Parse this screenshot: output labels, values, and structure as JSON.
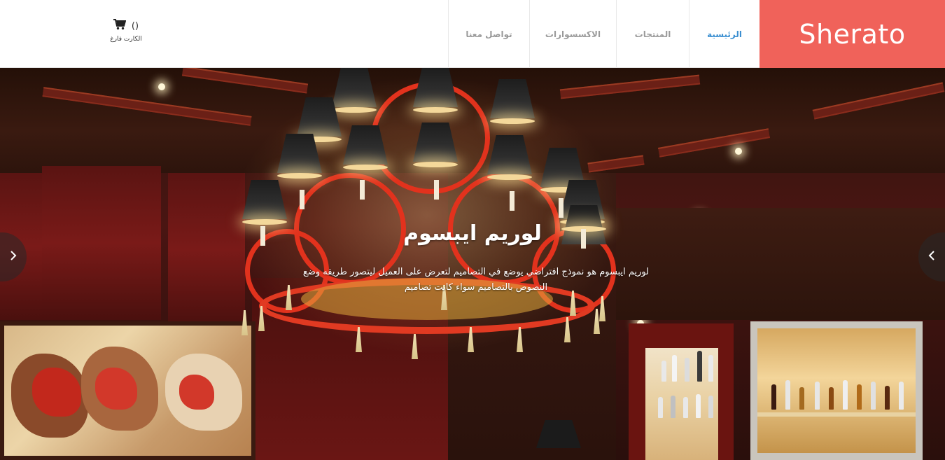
{
  "brand": {
    "name": "Sherato",
    "color": "#f0625a"
  },
  "nav": {
    "items": [
      {
        "label": "الرئيسية",
        "active": true
      },
      {
        "label": "المنتجات",
        "active": false
      },
      {
        "label": "الاكسسوارات",
        "active": false
      },
      {
        "label": "تواصل معنا",
        "active": false
      }
    ],
    "active_color": "#3b8fd1"
  },
  "cart": {
    "icon": "cart-icon",
    "count": "()",
    "label": "الكارت فارغ"
  },
  "hero": {
    "title": "لوريم ايبسوم",
    "text": "لوريم ايبسوم هو نموذج افتراضي يوضع في التصاميم لتعرض على العميل ليتصور طريقه وضع النصوص بالتصاميم سواء كانت تصاميم",
    "prev_icon": "chevron-right-icon",
    "next_icon": "chevron-left-icon"
  }
}
